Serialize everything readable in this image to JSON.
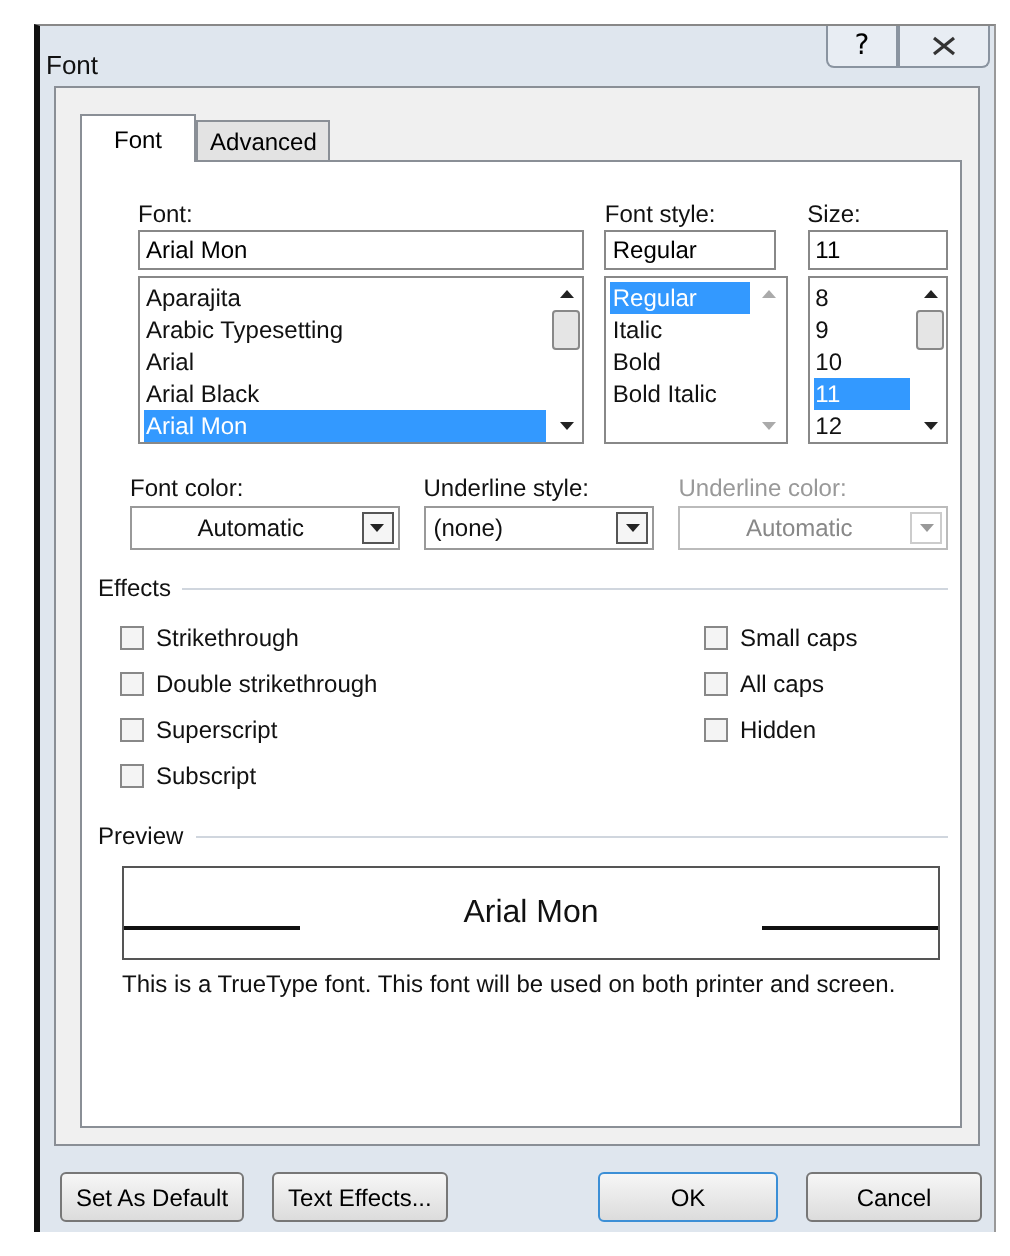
{
  "window": {
    "title": "Font",
    "help": "?"
  },
  "tabs": [
    {
      "label": "Font",
      "selected": true
    },
    {
      "label": "Advanced",
      "selected": false
    }
  ],
  "pickers": [
    {
      "label": "Font:",
      "value": "Arial Mon",
      "scrollable": true,
      "items": [
        {
          "label": "Aparajita",
          "selected": false
        },
        {
          "label": "Arabic Typesetting",
          "selected": false
        },
        {
          "label": "Arial",
          "selected": false
        },
        {
          "label": "Arial Black",
          "selected": false
        },
        {
          "label": "Arial Mon",
          "selected": true
        }
      ]
    },
    {
      "label": "Font style:",
      "value": "Regular",
      "scrollable": false,
      "items": [
        {
          "label": "Regular",
          "selected": true
        },
        {
          "label": "Italic",
          "selected": false
        },
        {
          "label": "Bold",
          "selected": false
        },
        {
          "label": "Bold Italic",
          "selected": false
        }
      ]
    },
    {
      "label": "Size:",
      "value": "11",
      "scrollable": true,
      "items": [
        {
          "label": "8",
          "selected": false
        },
        {
          "label": "9",
          "selected": false
        },
        {
          "label": "10",
          "selected": false
        },
        {
          "label": "11",
          "selected": true
        },
        {
          "label": "12",
          "selected": false
        }
      ]
    }
  ],
  "dropdowns": [
    {
      "label": "Font color:",
      "value": "Automatic",
      "kind": "color",
      "disabled": false
    },
    {
      "label": "Underline style:",
      "value": "(none)",
      "kind": "list",
      "disabled": false
    },
    {
      "label": "Underline color:",
      "value": "Automatic",
      "kind": "color",
      "disabled": true
    }
  ],
  "effects": {
    "title": "Effects",
    "left": [
      {
        "label": "Strikethrough",
        "checked": false
      },
      {
        "label": "Double strikethrough",
        "checked": false
      },
      {
        "label": "Superscript",
        "checked": false
      },
      {
        "label": "Subscript",
        "checked": false
      }
    ],
    "right": [
      {
        "label": "Small caps",
        "checked": false
      },
      {
        "label": "All caps",
        "checked": false
      },
      {
        "label": "Hidden",
        "checked": false
      }
    ]
  },
  "preview": {
    "title": "Preview",
    "sample": "Arial Mon",
    "note": "This is a TrueType font. This font will be used on both printer and screen."
  },
  "buttons": [
    {
      "label": "Set As Default",
      "default": false
    },
    {
      "label": "Text Effects...",
      "default": false
    },
    {
      "label": "OK",
      "default": true
    },
    {
      "label": "Cancel",
      "default": false
    }
  ]
}
